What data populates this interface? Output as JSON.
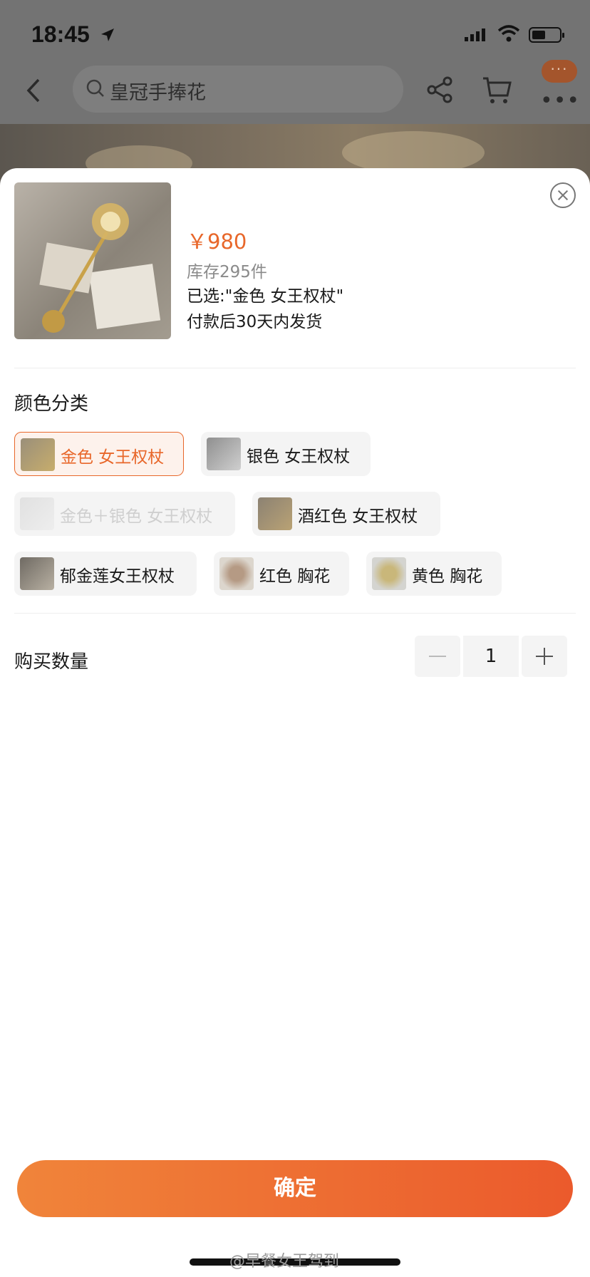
{
  "status_bar": {
    "time": "18:45"
  },
  "nav": {
    "search_text": "皇冠手捧花",
    "more_badge": "···",
    "more_dots": "•••"
  },
  "product": {
    "price": "￥980",
    "stock": "库存295件",
    "selected": "已选:\"金色 女王权杖\"",
    "shipping": "付款后30天内发货"
  },
  "color_section": {
    "title": "颜色分类",
    "options": [
      {
        "label": "金色 女王权杖",
        "state": "active"
      },
      {
        "label": "银色 女王权杖",
        "state": "normal"
      },
      {
        "label": "金色＋银色 女王权杖",
        "state": "disabled"
      },
      {
        "label": "酒红色 女王权杖",
        "state": "normal"
      },
      {
        "label": "郁金莲女王权杖",
        "state": "normal"
      },
      {
        "label": "红色 胸花",
        "state": "normal"
      },
      {
        "label": "黄色 胸花",
        "state": "normal"
      }
    ]
  },
  "quantity": {
    "label": "购买数量",
    "value": "1"
  },
  "confirm_label": "确定",
  "watermark": "@早餐女王驾到",
  "colors": {
    "accent": "#e8672a",
    "button_start": "#f0843a",
    "button_end": "#eb5a2c"
  }
}
